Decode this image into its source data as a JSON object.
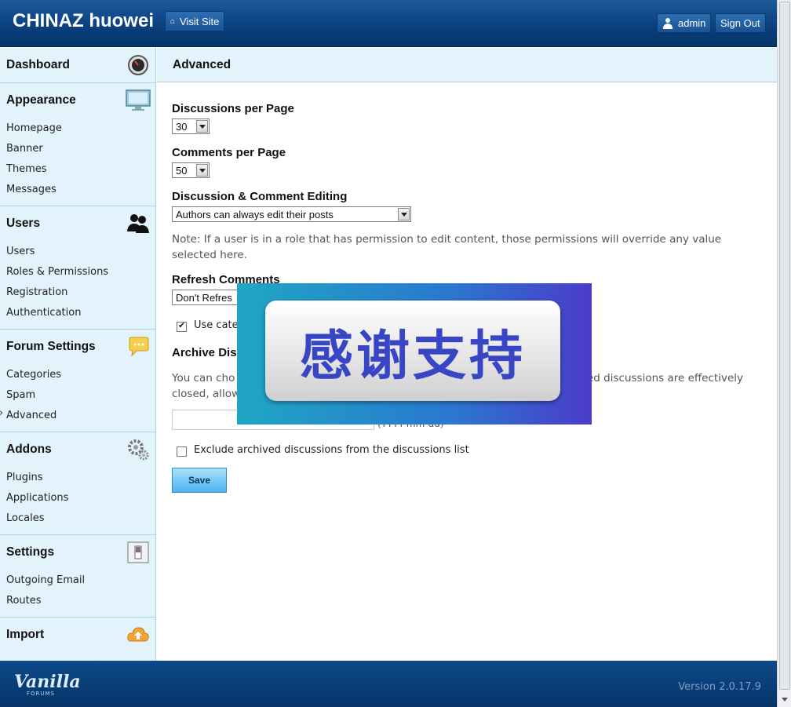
{
  "header": {
    "site_title": "CHINAZ huowei",
    "visit_site": "Visit Site",
    "user": "admin",
    "sign_out": "Sign Out"
  },
  "sidebar": {
    "dashboard": "Dashboard",
    "appearance": {
      "title": "Appearance",
      "items": [
        "Homepage",
        "Banner",
        "Themes",
        "Messages"
      ]
    },
    "users": {
      "title": "Users",
      "items": [
        "Users",
        "Roles & Permissions",
        "Registration",
        "Authentication"
      ]
    },
    "forum": {
      "title": "Forum Settings",
      "items": [
        "Categories",
        "Spam",
        "Advanced"
      ]
    },
    "addons": {
      "title": "Addons",
      "items": [
        "Plugins",
        "Applications",
        "Locales"
      ]
    },
    "settings": {
      "title": "Settings",
      "items": [
        "Outgoing Email",
        "Routes"
      ]
    },
    "import": "Import"
  },
  "main": {
    "title": "Advanced",
    "discussions_per_page": {
      "label": "Discussions per Page",
      "value": "30"
    },
    "comments_per_page": {
      "label": "Comments per Page",
      "value": "50"
    },
    "editing": {
      "label": "Discussion & Comment Editing",
      "value": "Authors can always edit their posts"
    },
    "note": "Note: If a user is in a role that has permission to edit content, those permissions will override any value selected here.",
    "refresh": {
      "label": "Refresh Comments",
      "value": "Don't Refres"
    },
    "use_categories": "Use categ",
    "archive": {
      "label": "Archive Dis",
      "text_left": "You can cho",
      "text_left2": "closed, allow",
      "text_right": "ed discussions are effectively",
      "date_hint": "(YYYY-mm-dd)"
    },
    "exclude_archived": "Exclude archived discussions from the discussions list",
    "save": "Save"
  },
  "overlay": {
    "text": "感谢支持"
  },
  "footer": {
    "logo": "Vanilla",
    "logo_sub": "FORUMS",
    "version": "Version 2.0.17.9"
  }
}
